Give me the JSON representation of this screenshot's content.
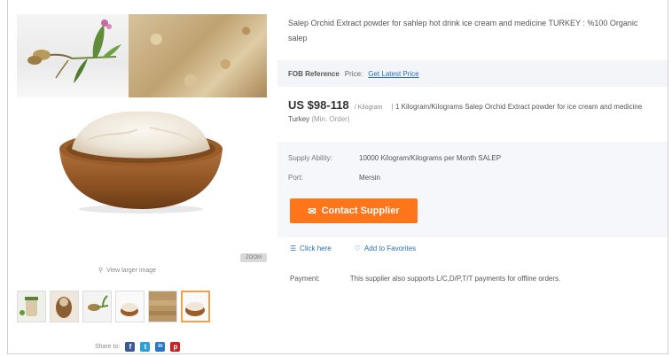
{
  "product": {
    "title": "Salep Orchid Extract powder for sahlep hot drink ice cream and medicine TURKEY : %100 Organic salep"
  },
  "reference_bar": {
    "label": "FOB Reference",
    "label_suffix": "Price:",
    "link": "Get Latest Price"
  },
  "pricing": {
    "price": "US $98-118",
    "unit": "/ Kilogram",
    "separator": "|",
    "min_order": "1 Kilogram/Kilograms Salep Orchid Extract powder for ice cream and medicine Turkey",
    "min_order_suffix": "(Min. Order)"
  },
  "supply": {
    "supply_label": "Supply Ability:",
    "supply_value": "10000 Kilogram/Kilograms per Month SALEP",
    "port_label": "Port:",
    "port_value": "Mersin"
  },
  "contact_button": {
    "label": "Contact Supplier",
    "color": "#ff7519"
  },
  "actions": {
    "chat": "Click here",
    "favorite": "Add to Favorites"
  },
  "payment": {
    "label": "Payment:",
    "value": "This supplier also supports L/C,D/P,T/T payments for offline orders."
  },
  "gallery": {
    "view_larger": "View larger image",
    "zoom_badge": "ZOOM",
    "thumbnails": [
      "salep-jar",
      "figure-dried",
      "plant-roots",
      "powder-bowl-small",
      "bark-texture",
      "powder-bowl"
    ],
    "selected_index": 5
  },
  "share": {
    "label": "Share to:",
    "networks": [
      {
        "name": "facebook",
        "color": "#3b5998",
        "glyph": "f"
      },
      {
        "name": "twitter",
        "color": "#2b9fd9",
        "glyph": "t"
      },
      {
        "name": "linkedin",
        "color": "#2a77c6",
        "glyph": "in"
      },
      {
        "name": "pinterest",
        "color": "#cb2027",
        "glyph": "p"
      }
    ]
  }
}
